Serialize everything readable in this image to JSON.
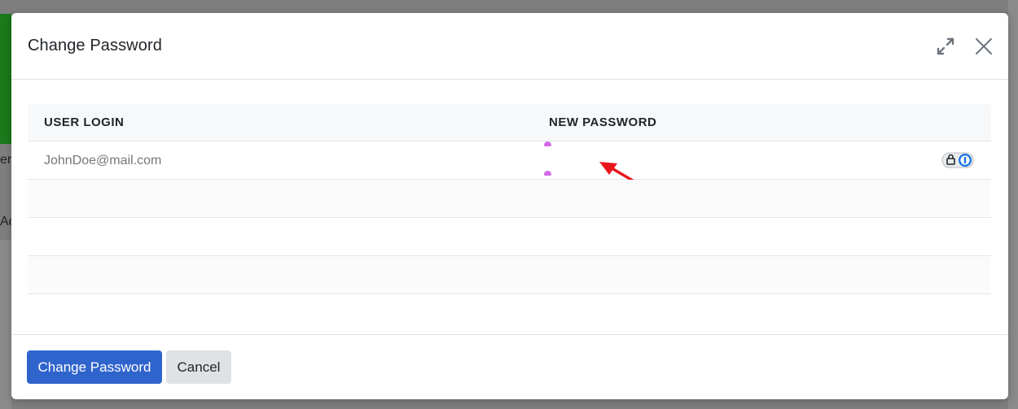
{
  "background": {
    "text_partial_1": "er",
    "text_partial_2": "Ac"
  },
  "modal": {
    "title": "Change Password",
    "expand_icon": "expand-arrows-icon",
    "close_icon": "close-icon"
  },
  "grid": {
    "columns": [
      "USER LOGIN",
      "NEW PASSWORD"
    ],
    "rows": [
      {
        "user_login": "JohnDoe@mail.com",
        "new_password": ""
      },
      {
        "user_login": "",
        "new_password": ""
      },
      {
        "user_login": "",
        "new_password": ""
      },
      {
        "user_login": "",
        "new_password": ""
      }
    ],
    "password_manager_icon": "password-manager-icon"
  },
  "footer": {
    "primary_label": "Change Password",
    "cancel_label": "Cancel"
  },
  "colors": {
    "primary": "#2f64cc",
    "secondary": "#dfe1e5",
    "annotation_arrow": "#e8161b",
    "caret": "#d36be8"
  }
}
